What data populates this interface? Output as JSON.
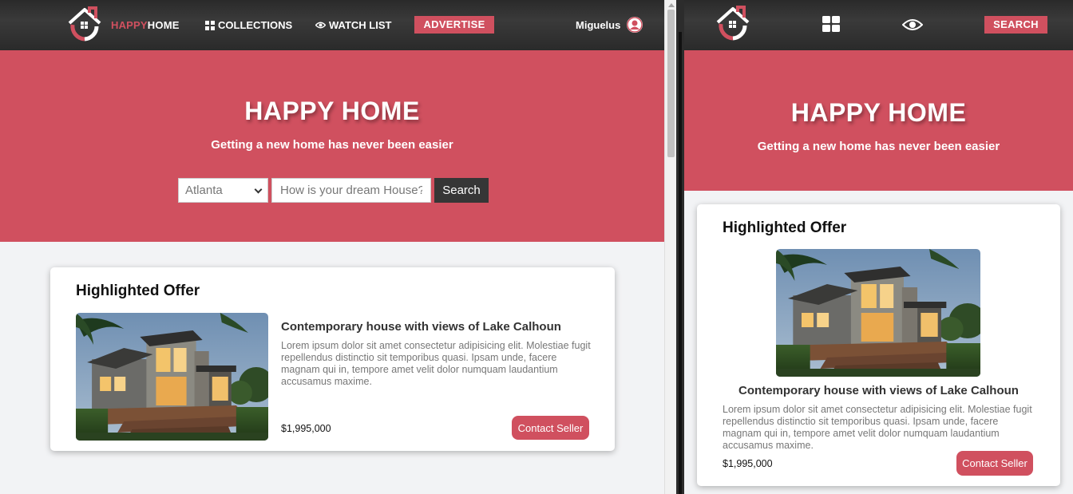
{
  "colors": {
    "accent": "#d0505f",
    "nav_bg": "#2e2e2e",
    "page_bg": "#f2f3f5",
    "search_button": "#363636"
  },
  "desktop": {
    "nav": {
      "brand_accent": "HAPPY",
      "brand_rest": "HOME",
      "collections_label": "COLLECTIONS",
      "collections_icon": "grid-icon",
      "watchlist_label": "WATCH LIST",
      "watchlist_icon": "eye-icon",
      "advertise_label": "ADVERTISE",
      "user_name": "Miguelus",
      "user_icon": "user-avatar-icon"
    },
    "hero": {
      "title": "HAPPY HOME",
      "subtitle": "Getting a new home has never been easier",
      "city_selected": "Atlanta",
      "search_placeholder": "How is your dream House?",
      "search_button": "Search"
    },
    "offer": {
      "heading": "Highlighted Offer",
      "title": "Contemporary house with views of Lake Calhoun",
      "description": "Lorem ipsum dolor sit amet consectetur adipisicing elit. Molestiae fugit repellendus distinctio sit temporibus quasi. Ipsam unde, facere magnam qui in, tempore amet velit dolor numquam laudantium accusamus maxime.",
      "price": "$1,995,000",
      "contact_button": "Contact Seller"
    }
  },
  "mobile": {
    "nav": {
      "collections_icon": "grid-icon",
      "watchlist_icon": "eye-icon",
      "search_label": "SEARCH"
    },
    "hero": {
      "title": "HAPPY HOME",
      "subtitle": "Getting a new home has never been easier"
    },
    "offer": {
      "heading": "Highlighted Offer",
      "title": "Contemporary house with views of Lake Calhoun",
      "description": "Lorem ipsum dolor sit amet consectetur adipisicing elit. Molestiae fugit repellendus distinctio sit temporibus quasi. Ipsam unde, facere magnam qui in, tempore amet velit dolor numquam laudantium accusamus maxime.",
      "price": "$1,995,000",
      "contact_button": "Contact Seller"
    }
  }
}
